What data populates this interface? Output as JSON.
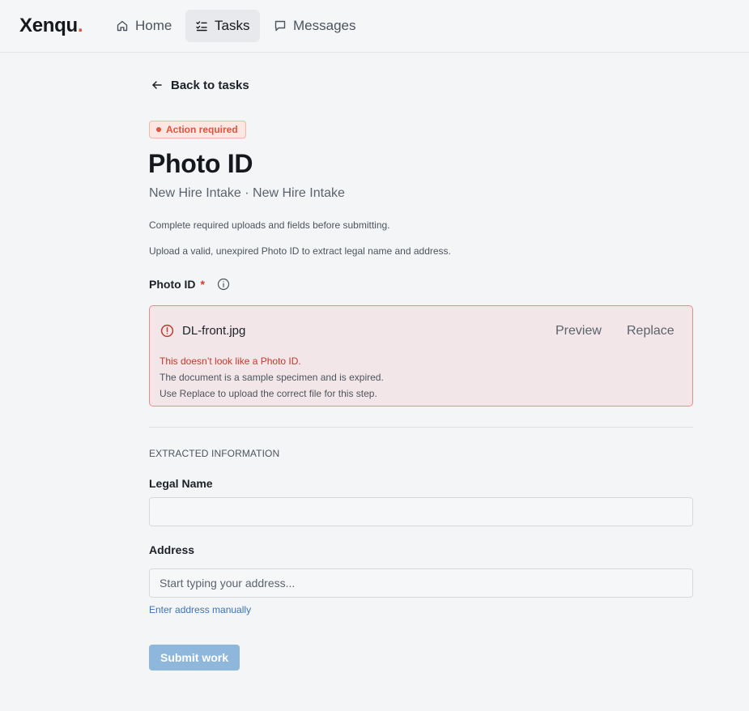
{
  "app": {
    "logo_text": "Xenqu",
    "logo_dot": ".",
    "brand_accent": "#e0533d"
  },
  "nav": {
    "items": [
      {
        "label": "Home",
        "icon": "home-icon",
        "active": false
      },
      {
        "label": "Tasks",
        "icon": "checklist-icon",
        "active": true
      },
      {
        "label": "Messages",
        "icon": "chat-bubble-icon",
        "active": false
      }
    ]
  },
  "main": {
    "back_label": "Back to tasks",
    "badge": {
      "label": "Action required",
      "color": "#e0533d"
    },
    "title": "Photo ID",
    "subtitle": "New Hire Intake · New Hire Intake",
    "help_text_1": "Complete required uploads and fields before submitting.",
    "help_text_2": "Upload a valid, unexpired Photo ID to extract legal name and address.",
    "photo_field": {
      "label": "Photo ID",
      "required_marker": "*",
      "file_name": "DL-front.jpg",
      "preview_label": "Preview",
      "replace_label": "Replace",
      "error_title": "This doesn’t look like a Photo ID.",
      "error_detail": "The document is a sample specimen and is expired.",
      "error_hint": "Use Replace to upload the correct file for this step.",
      "error_color": "#c0392b"
    },
    "extracted": {
      "heading": "EXTRACTED INFORMATION",
      "legal_name": {
        "label": "Legal Name",
        "value": "",
        "placeholder": ""
      },
      "address": {
        "label": "Address",
        "value": "",
        "placeholder": "Start typing your address..."
      },
      "manual_link": "Enter address manually"
    },
    "submit_label": "Submit work",
    "submit_disabled": true,
    "submit_color": "#8fb7dc"
  }
}
